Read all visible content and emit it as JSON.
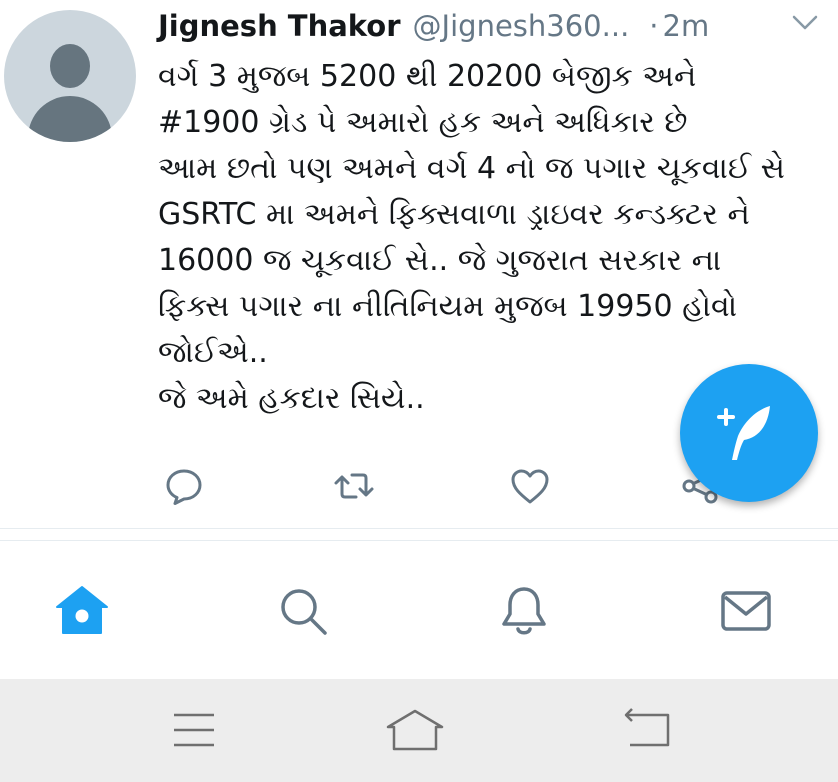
{
  "tweet": {
    "author_name": "Jignesh Thakor",
    "author_handle": "@Jignesh360...",
    "separator": "·",
    "time": "2m",
    "lines": [
      "વર્ગ 3 મુજબ 5200 થી 20200 બેજીક અને",
      "#1900 ગ્રેડ પે અમારો હક અને અધિકાર છે",
      "આમ છતો પણ અમને વર્ગ 4 નો જ પગાર ચૂકવાઈ સે",
      "GSRTC મા અમને ફિક્સવાળા ડ્રાઇવર કન્ડક્ટર ને",
      "16000 જ ચૂકવાઈ સે.. જે ગુજરાત સરકાર ના",
      "ફિક્સ પગાર ના નીતિનિયમ મુજબ 19950 હોવો",
      "જોઈએ..",
      "જે અમે હકદાર સિયે.."
    ],
    "actions": [
      "reply-icon",
      "retweet-icon",
      "like-icon",
      "share-icon"
    ]
  },
  "fab": {
    "icon": "compose-tweet-icon"
  },
  "tabbar": {
    "tabs": [
      "home-icon",
      "search-icon",
      "notifications-icon",
      "messages-icon"
    ],
    "active": "home"
  },
  "system_nav": [
    "menu-icon",
    "home-icon",
    "back-icon"
  ],
  "colors": {
    "accent": "#1da1f2",
    "text": "#14171a",
    "secondary": "#657786",
    "divider": "#e6ecf0",
    "nav_background": "#ededed"
  }
}
